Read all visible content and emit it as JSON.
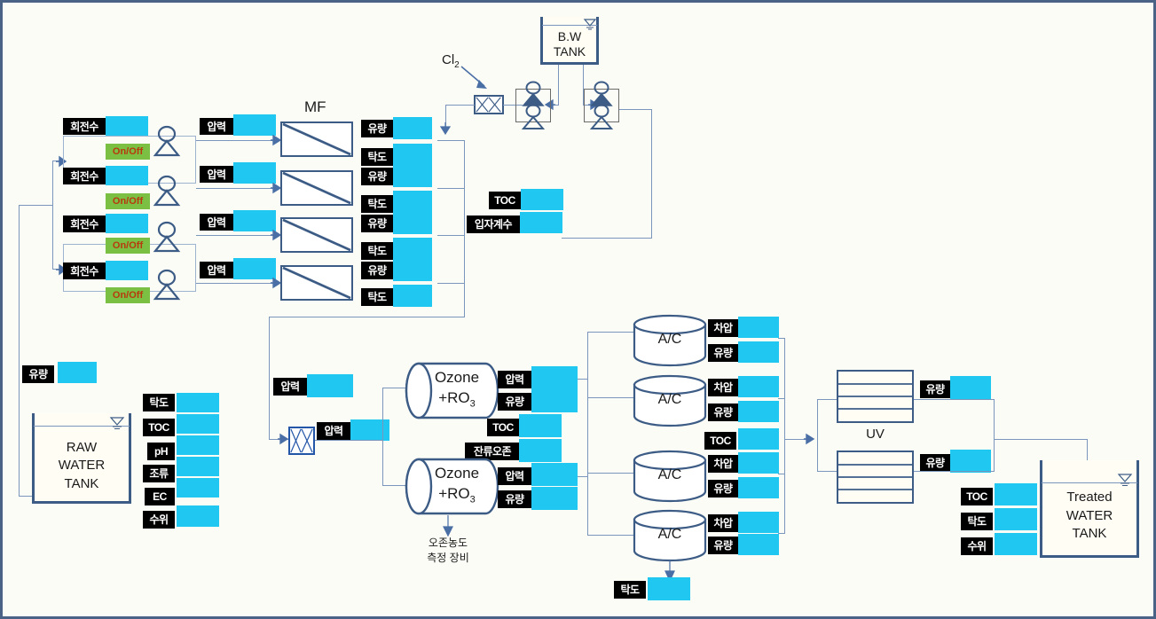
{
  "diagram": {
    "title": "Water Treatment Process Diagram",
    "colors": {
      "value_field": "#20c7f0",
      "tag_background": "#000000",
      "tag_text": "#ffffff",
      "onoff_background": "#7bc043",
      "onoff_text": "#b8390e",
      "pipe": "#7a96bd",
      "equipment_outline": "#3c5c86",
      "canvas_border": "#4a6285"
    }
  },
  "labels": {
    "rpm": "회전수",
    "onoff": "On/Off",
    "pressure": "압력",
    "flow": "유량",
    "turbidity": "탁도",
    "toc": "TOC",
    "particle_count": "입자계수",
    "ph": "pH",
    "algae": "조류",
    "ec": "EC",
    "water_level": "수위",
    "diff_pressure": "차압",
    "residual_ozone": "잔류오존"
  },
  "equipment": {
    "mf_label": "MF",
    "uv_label": "UV",
    "bw_tank": "B.W\nTANK",
    "bw_tank_line1": "B.W",
    "bw_tank_line2": "TANK",
    "cl2": "Cl",
    "cl2_sub": "2",
    "raw_tank_line1": "RAW",
    "raw_tank_line2": "WATER",
    "raw_tank_line3": "TANK",
    "treated_tank_line1": "Treated",
    "treated_tank_line2": "WATER",
    "treated_tank_line3": "TANK",
    "ozone_line1": "Ozone",
    "ozone_line2_pre": "+RO",
    "ozone_line2_sub": "3",
    "ac_label": "A/C",
    "ozone_meter_line1": "오존농도",
    "ozone_meter_line2": "측정 장비"
  },
  "mf_trains": [
    {
      "rpm_label": "회전수",
      "onoff_label": "On/Off",
      "pressure_label": "압력",
      "flow_label": "유량",
      "turbidity_label": "탁도"
    },
    {
      "rpm_label": "회전수",
      "onoff_label": "On/Off",
      "pressure_label": "압력",
      "flow_label": "유량",
      "turbidity_label": "탁도"
    },
    {
      "rpm_label": "회전수",
      "onoff_label": "On/Off",
      "pressure_label": "압력",
      "flow_label": "유량",
      "turbidity_label": "탁도"
    },
    {
      "rpm_label": "회전수",
      "onoff_label": "On/Off",
      "pressure_label": "압력",
      "flow_label": "유량",
      "turbidity_label": "탁도"
    }
  ],
  "mf_outlet": {
    "toc_label": "TOC",
    "particle_label": "입자계수"
  },
  "raw_water_tank": {
    "inlet_flow_label": "유량",
    "measurements": [
      {
        "label": "탁도"
      },
      {
        "label": "TOC"
      },
      {
        "label": "pH"
      },
      {
        "label": "조류"
      },
      {
        "label": "EC"
      },
      {
        "label": "수위"
      }
    ]
  },
  "ozone_section": {
    "inlet_pressure_label": "압력",
    "mixer_pressure_label": "압력",
    "units": [
      {
        "pressure_label": "압력",
        "flow_label": "유량"
      },
      {
        "pressure_label": "압력",
        "flow_label": "유량"
      }
    ],
    "toc_label": "TOC",
    "residual_ozone_label": "잔류오존",
    "meter_line1": "오존농도",
    "meter_line2": "측정 장비"
  },
  "ac_section": {
    "units": [
      {
        "name": "A/C",
        "dp_label": "차압",
        "flow_label": "유량"
      },
      {
        "name": "A/C",
        "dp_label": "차압",
        "flow_label": "유량"
      },
      {
        "name": "A/C",
        "dp_label": "차압",
        "flow_label": "유량"
      },
      {
        "name": "A/C",
        "dp_label": "차압",
        "flow_label": "유량"
      }
    ],
    "toc_label": "TOC",
    "outlet_turbidity_label": "탁도"
  },
  "uv_section": {
    "name": "UV",
    "units": [
      {
        "flow_label": "유량"
      },
      {
        "flow_label": "유량"
      }
    ]
  },
  "treated_water_tank": {
    "measurements": [
      {
        "label": "TOC"
      },
      {
        "label": "탁도"
      },
      {
        "label": "수위"
      }
    ]
  }
}
